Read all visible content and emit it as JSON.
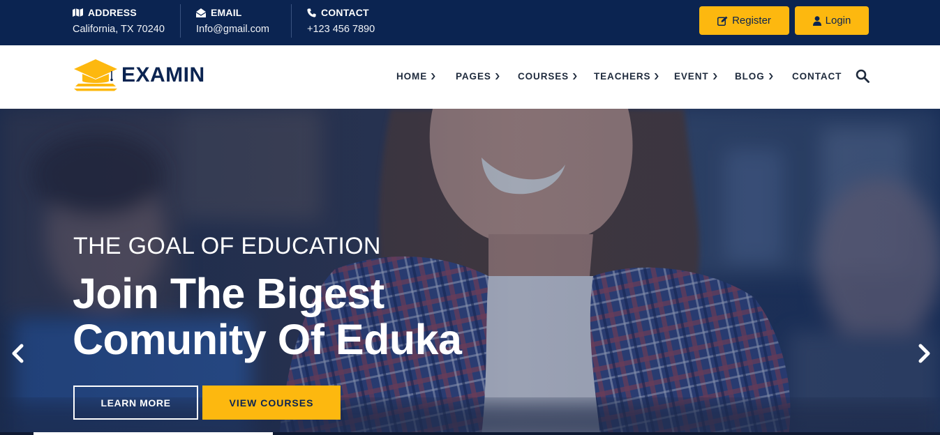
{
  "topbar": {
    "address": {
      "title": "ADDRESS",
      "value": "California, TX 70240",
      "icon": "map-icon"
    },
    "email": {
      "title": "EMAIL",
      "value": "Info@gmail.com",
      "icon": "envelope-icon"
    },
    "contact": {
      "title": "CONTACT",
      "value": "+123 456 7890",
      "icon": "phone-icon"
    },
    "register_label": "Register",
    "login_label": "Login"
  },
  "navbar": {
    "logo_text": "EXAMIN",
    "items": [
      {
        "label": "HOME",
        "has_dropdown": true
      },
      {
        "label": "PAGES",
        "has_dropdown": true
      },
      {
        "label": "COURSES",
        "has_dropdown": true
      },
      {
        "label": "TEACHERS",
        "has_dropdown": true
      },
      {
        "label": "EVENT",
        "has_dropdown": true
      },
      {
        "label": "BLOG",
        "has_dropdown": true
      },
      {
        "label": "CONTACT",
        "has_dropdown": false
      }
    ]
  },
  "hero": {
    "subtitle": "THE GOAL OF EDUCATION",
    "headline_line1": "Join The Bigest",
    "headline_line2": "Comunity Of Eduka",
    "learn_more_label": "LEARN MORE",
    "view_courses_label": "VIEW COURSES",
    "slide_progress": 0.25
  },
  "colors": {
    "navy": "#0b2451",
    "accent_yellow": "#fdb80f",
    "white": "#ffffff"
  }
}
